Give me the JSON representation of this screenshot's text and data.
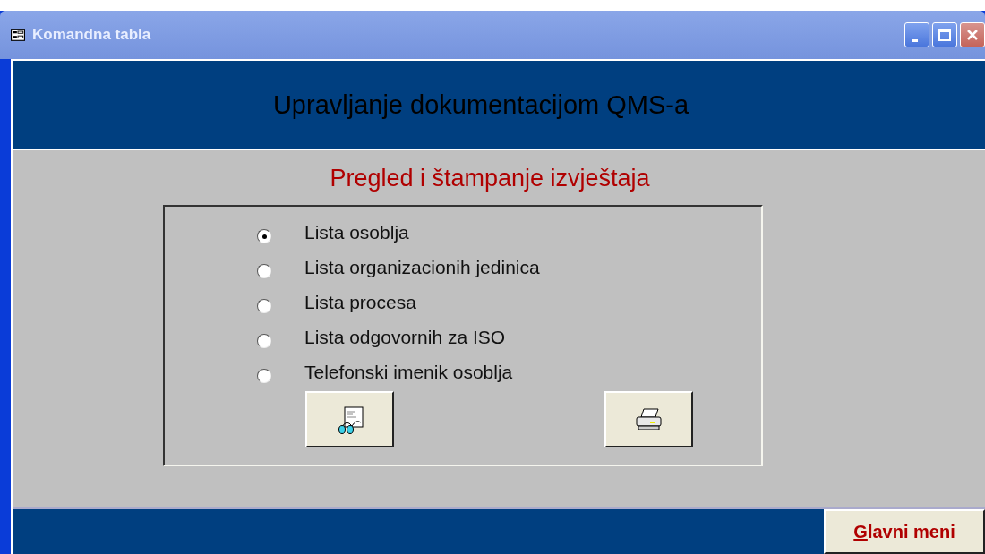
{
  "window": {
    "title": "Komandna tabla"
  },
  "header": {
    "title": "Upravljanje dokumentacijom QMS-a"
  },
  "section_title": "Pregled i štampanje izvještaja",
  "reports": [
    {
      "label": "Lista osoblja",
      "selected": true
    },
    {
      "label": "Lista organizacionih jedinica",
      "selected": false
    },
    {
      "label": "Lista procesa",
      "selected": false
    },
    {
      "label": "Lista odgovornih za ISO",
      "selected": false
    },
    {
      "label": "Telefonski imenik osoblja",
      "selected": false
    }
  ],
  "footer": {
    "button": "Glavni meni"
  }
}
